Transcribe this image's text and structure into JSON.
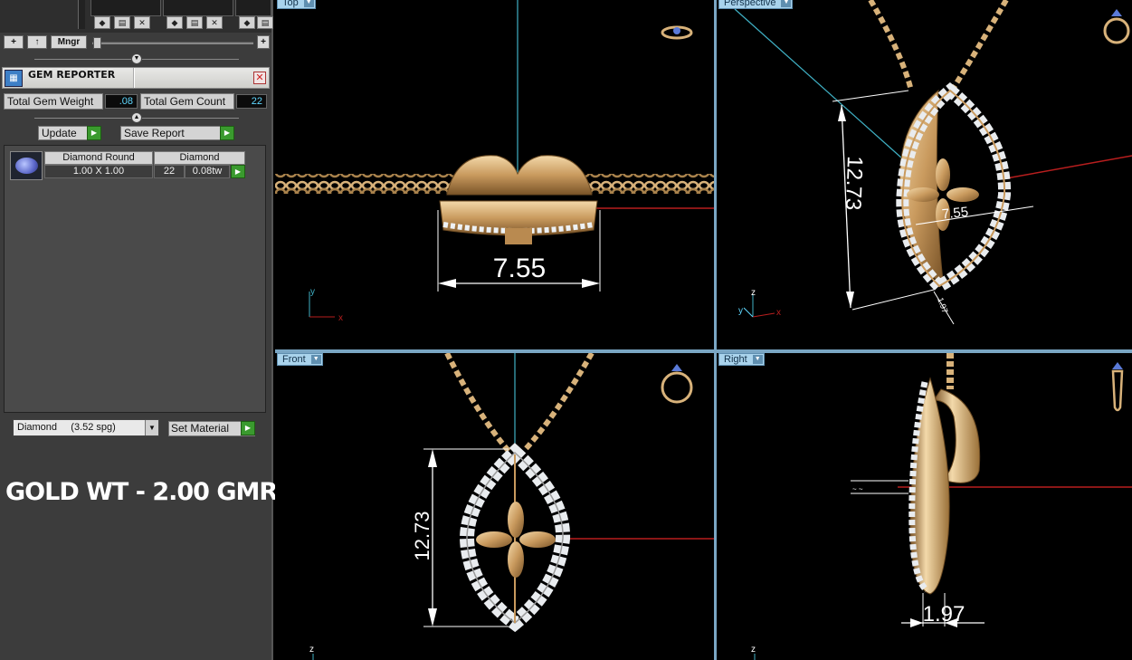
{
  "toolbar": {
    "add_label": "+",
    "up_label": "↑",
    "manager_label": "Mngr",
    "expand_label": "+"
  },
  "gem_reporter": {
    "title": "GEM REPORTER",
    "close_label": "✕",
    "total_weight_label": "Total Gem Weight",
    "total_weight_value": ".08",
    "total_count_label": "Total Gem Count",
    "total_count_value": "22",
    "update_label": "Update",
    "save_report_label": "Save Report",
    "rows": [
      {
        "shape": "Diamond Round",
        "size": "1.00 X 1.00",
        "material": "Diamond",
        "count": "22",
        "weight": "0.08tw"
      }
    ]
  },
  "material": {
    "selected": "Diamond     (3.52 spg)",
    "set_label": "Set Material"
  },
  "note": "GOLD WT - 2.00 GMR",
  "viewports": {
    "top": {
      "label": "Top",
      "dimension": "7.55",
      "axis_a": "y",
      "axis_b": "x"
    },
    "perspective": {
      "label": "Perspective",
      "dim_height": "12.73",
      "dim_width": "7.55",
      "dim_depth": "1.97",
      "axis_a": "z",
      "axis_b": "x",
      "axis_c": "y"
    },
    "front": {
      "label": "Front",
      "dimension": "12.73",
      "axis_a": "z"
    },
    "right": {
      "label": "Right",
      "dimension": "1.97",
      "axis_a": "z"
    }
  },
  "colors": {
    "gold": "#d8b27a",
    "gold_dark": "#8a6438",
    "diamond": "#e9ecef",
    "axis_cyan": "#3fb0c4",
    "axis_red": "#b81e1e",
    "panel_bg": "#3c3c3c",
    "viewport_tab": "#a9d3ec",
    "accent_green": "#3a9a2e",
    "value_text": "#5fd8ff"
  }
}
